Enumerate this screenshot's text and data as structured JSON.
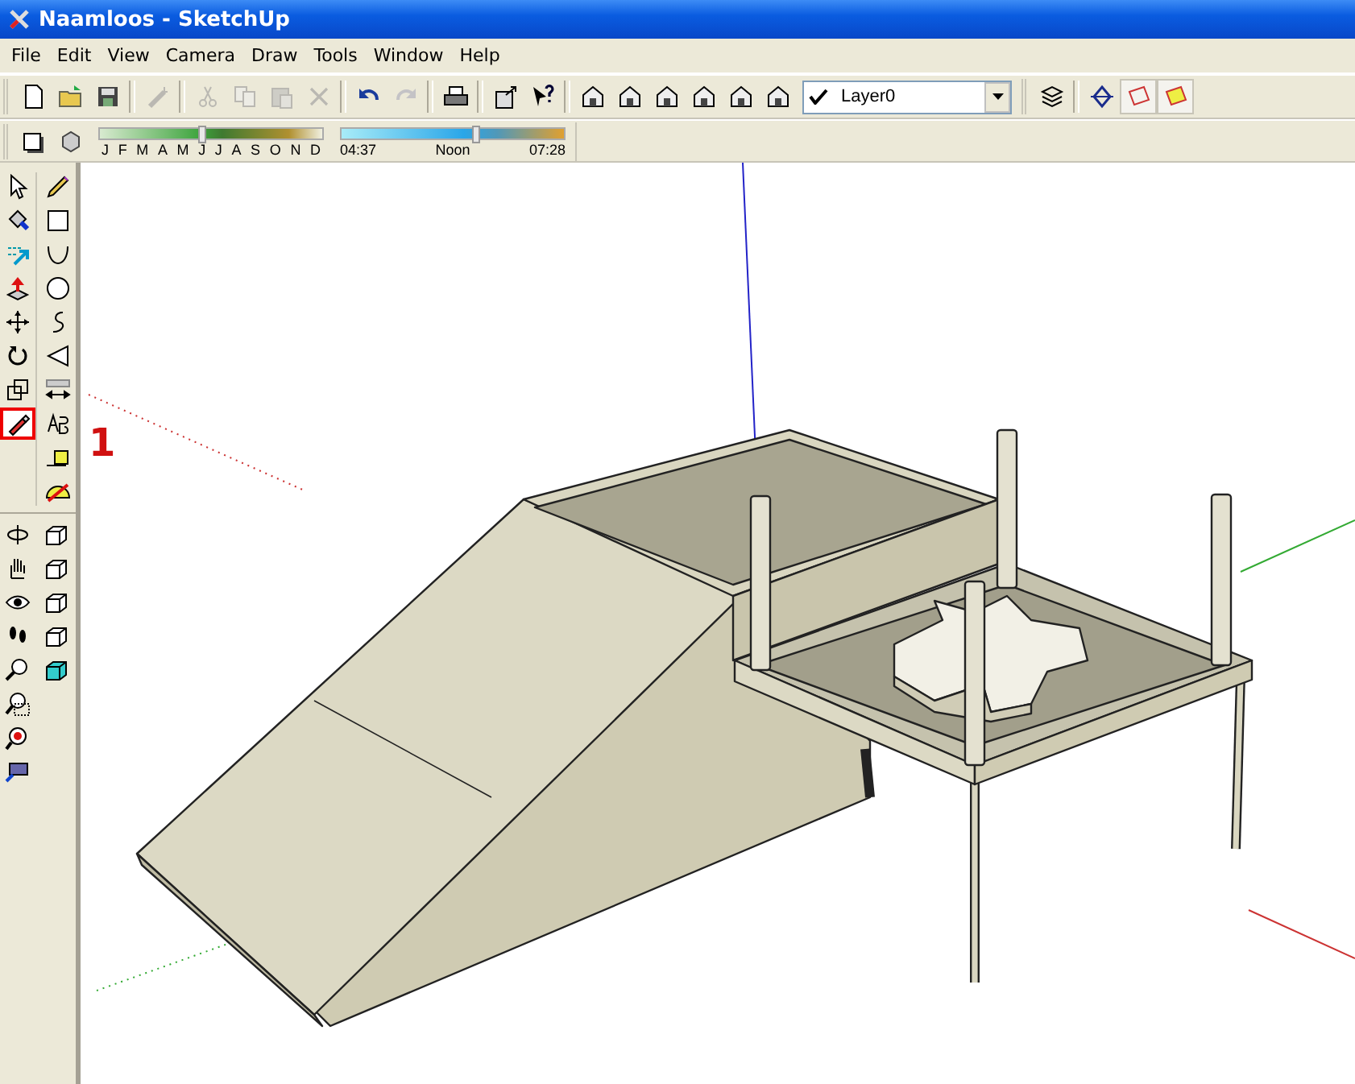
{
  "window": {
    "title": "Naamloos - SketchUp"
  },
  "menu": [
    "File",
    "Edit",
    "View",
    "Camera",
    "Draw",
    "Tools",
    "Window",
    "Help"
  ],
  "toolbar": [
    {
      "kind": "page",
      "disabled": false
    },
    {
      "kind": "folder",
      "disabled": false
    },
    {
      "kind": "disk",
      "disabled": false
    },
    {
      "kind": "sep"
    },
    {
      "kind": "wand",
      "disabled": true
    },
    {
      "kind": "sep"
    },
    {
      "kind": "scissors",
      "disabled": true
    },
    {
      "kind": "copy",
      "disabled": true
    },
    {
      "kind": "paste",
      "disabled": true
    },
    {
      "kind": "cross",
      "disabled": true
    },
    {
      "kind": "sep"
    },
    {
      "kind": "undo",
      "disabled": false
    },
    {
      "kind": "redo",
      "disabled": true
    },
    {
      "kind": "sep"
    },
    {
      "kind": "printer",
      "disabled": false
    },
    {
      "kind": "sep"
    },
    {
      "kind": "info",
      "disabled": false
    },
    {
      "kind": "help",
      "disabled": false
    },
    {
      "kind": "sep"
    },
    {
      "kind": "house",
      "disabled": false
    },
    {
      "kind": "house",
      "disabled": false
    },
    {
      "kind": "house",
      "disabled": false
    },
    {
      "kind": "house",
      "disabled": false
    },
    {
      "kind": "house",
      "disabled": false
    },
    {
      "kind": "house",
      "disabled": false
    }
  ],
  "layer": {
    "checked": true,
    "value": "Layer0"
  },
  "layer_tools": [
    {
      "kind": "layers",
      "selected": false
    },
    {
      "kind": "sep"
    },
    {
      "kind": "section",
      "selected": false
    },
    {
      "kind": "section-cut",
      "selected": true
    },
    {
      "kind": "section-fill",
      "selected": true
    }
  ],
  "shadow_bar": {
    "months": [
      "J",
      "F",
      "M",
      "A",
      "M",
      "J",
      "J",
      "A",
      "S",
      "O",
      "N",
      "D"
    ],
    "date": {
      "level": 0.46
    },
    "time": {
      "level": 0.6
    },
    "start": "04:37",
    "middle": "Noon",
    "end": "07:28"
  },
  "tool_groups": [
    {
      "column_1": [
        {
          "kind": "arrow",
          "selected": false
        },
        {
          "kind": "bucket",
          "selected": false
        },
        {
          "kind": "followme",
          "selected": false
        },
        {
          "kind": "pushpull",
          "selected": false
        },
        {
          "kind": "move",
          "selected": false
        },
        {
          "kind": "rotate",
          "selected": false
        },
        {
          "kind": "scale",
          "selected": false
        },
        {
          "kind": "eraser",
          "selected": true
        }
      ],
      "column_2": [
        {
          "kind": "pencil",
          "selected": false
        },
        {
          "kind": "rectangle",
          "selected": false
        },
        {
          "kind": "arc",
          "selected": false
        },
        {
          "kind": "circle",
          "selected": false
        },
        {
          "kind": "freehand",
          "selected": false
        },
        {
          "kind": "triangle",
          "selected": false
        },
        {
          "kind": "dimension",
          "selected": false
        },
        {
          "kind": "text",
          "selected": false
        },
        {
          "kind": "tape",
          "selected": false
        },
        {
          "kind": "protractor",
          "selected": false
        }
      ]
    },
    {
      "column_1": [
        {
          "kind": "orbit",
          "selected": false
        },
        {
          "kind": "hand",
          "selected": false
        },
        {
          "kind": "eye",
          "selected": false
        },
        {
          "kind": "footprints",
          "selected": false
        },
        {
          "kind": "magnifier",
          "selected": false
        },
        {
          "kind": "zoomwindow",
          "selected": false
        },
        {
          "kind": "zoomextents",
          "selected": false
        },
        {
          "kind": "camera",
          "selected": false
        }
      ],
      "column_2": [
        {
          "kind": "cube",
          "selected": false
        },
        {
          "kind": "cube",
          "selected": false
        },
        {
          "kind": "cube",
          "selected": false
        },
        {
          "kind": "cube",
          "selected": false
        },
        {
          "kind": "cube-cyan",
          "selected": false
        }
      ]
    }
  ],
  "annotation": "1"
}
